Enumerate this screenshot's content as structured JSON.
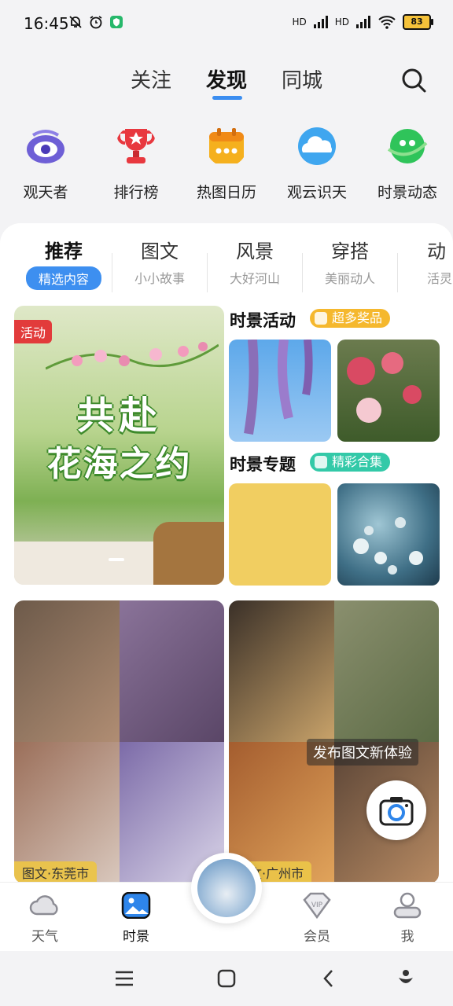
{
  "status": {
    "time": "16:45",
    "signal1": "HD",
    "signal2": "HD",
    "battery": "83"
  },
  "top_tabs": [
    {
      "label": "关注"
    },
    {
      "label": "发现"
    },
    {
      "label": "同城"
    }
  ],
  "categories": [
    {
      "label": "观天者",
      "icon": "eye-icon"
    },
    {
      "label": "排行榜",
      "icon": "trophy-icon"
    },
    {
      "label": "热图日历",
      "icon": "calendar-icon"
    },
    {
      "label": "观云识天",
      "icon": "cloud-icon"
    },
    {
      "label": "时景动态",
      "icon": "planet-icon"
    }
  ],
  "sub_tabs": [
    {
      "title": "推荐",
      "sub": "精选内容"
    },
    {
      "title": "图文",
      "sub": "小小故事"
    },
    {
      "title": "风景",
      "sub": "大好河山"
    },
    {
      "title": "穿搭",
      "sub": "美丽动人"
    },
    {
      "title": "动",
      "sub": "活灵"
    }
  ],
  "banner": {
    "tag": "活动",
    "title_line1": "共赴",
    "title_line2": "花海之约"
  },
  "sections": {
    "activity": {
      "title": "时景活动",
      "badge": "超多奖品"
    },
    "topic": {
      "title": "时景专题",
      "badge": "精彩合集"
    }
  },
  "feed": [
    {
      "caption": "图文·东莞市"
    },
    {
      "caption": "图文·广州市"
    }
  ],
  "promo_text": "发布图文新体验",
  "bottom_nav": [
    {
      "label": "天气",
      "icon": "cloud-outline-icon"
    },
    {
      "label": "时景",
      "icon": "picture-icon"
    },
    {
      "label": "会员",
      "icon": "vip-icon"
    },
    {
      "label": "我",
      "icon": "person-icon"
    }
  ],
  "colors": {
    "accent": "#3b8df0",
    "activity_badge": "#f5b82e",
    "topic_badge": "#33c9a8",
    "tag_red": "#e23b3b"
  }
}
